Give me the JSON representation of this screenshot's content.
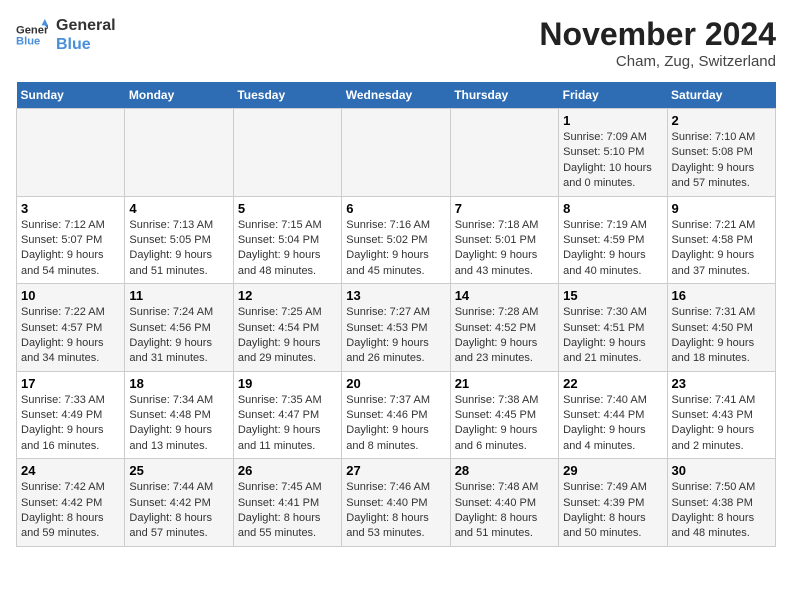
{
  "header": {
    "logo_line1": "General",
    "logo_line2": "Blue",
    "month_title": "November 2024",
    "location": "Cham, Zug, Switzerland"
  },
  "weekdays": [
    "Sunday",
    "Monday",
    "Tuesday",
    "Wednesday",
    "Thursday",
    "Friday",
    "Saturday"
  ],
  "weeks": [
    [
      {
        "day": "",
        "info": ""
      },
      {
        "day": "",
        "info": ""
      },
      {
        "day": "",
        "info": ""
      },
      {
        "day": "",
        "info": ""
      },
      {
        "day": "",
        "info": ""
      },
      {
        "day": "1",
        "info": "Sunrise: 7:09 AM\nSunset: 5:10 PM\nDaylight: 10 hours and 0 minutes."
      },
      {
        "day": "2",
        "info": "Sunrise: 7:10 AM\nSunset: 5:08 PM\nDaylight: 9 hours and 57 minutes."
      }
    ],
    [
      {
        "day": "3",
        "info": "Sunrise: 7:12 AM\nSunset: 5:07 PM\nDaylight: 9 hours and 54 minutes."
      },
      {
        "day": "4",
        "info": "Sunrise: 7:13 AM\nSunset: 5:05 PM\nDaylight: 9 hours and 51 minutes."
      },
      {
        "day": "5",
        "info": "Sunrise: 7:15 AM\nSunset: 5:04 PM\nDaylight: 9 hours and 48 minutes."
      },
      {
        "day": "6",
        "info": "Sunrise: 7:16 AM\nSunset: 5:02 PM\nDaylight: 9 hours and 45 minutes."
      },
      {
        "day": "7",
        "info": "Sunrise: 7:18 AM\nSunset: 5:01 PM\nDaylight: 9 hours and 43 minutes."
      },
      {
        "day": "8",
        "info": "Sunrise: 7:19 AM\nSunset: 4:59 PM\nDaylight: 9 hours and 40 minutes."
      },
      {
        "day": "9",
        "info": "Sunrise: 7:21 AM\nSunset: 4:58 PM\nDaylight: 9 hours and 37 minutes."
      }
    ],
    [
      {
        "day": "10",
        "info": "Sunrise: 7:22 AM\nSunset: 4:57 PM\nDaylight: 9 hours and 34 minutes."
      },
      {
        "day": "11",
        "info": "Sunrise: 7:24 AM\nSunset: 4:56 PM\nDaylight: 9 hours and 31 minutes."
      },
      {
        "day": "12",
        "info": "Sunrise: 7:25 AM\nSunset: 4:54 PM\nDaylight: 9 hours and 29 minutes."
      },
      {
        "day": "13",
        "info": "Sunrise: 7:27 AM\nSunset: 4:53 PM\nDaylight: 9 hours and 26 minutes."
      },
      {
        "day": "14",
        "info": "Sunrise: 7:28 AM\nSunset: 4:52 PM\nDaylight: 9 hours and 23 minutes."
      },
      {
        "day": "15",
        "info": "Sunrise: 7:30 AM\nSunset: 4:51 PM\nDaylight: 9 hours and 21 minutes."
      },
      {
        "day": "16",
        "info": "Sunrise: 7:31 AM\nSunset: 4:50 PM\nDaylight: 9 hours and 18 minutes."
      }
    ],
    [
      {
        "day": "17",
        "info": "Sunrise: 7:33 AM\nSunset: 4:49 PM\nDaylight: 9 hours and 16 minutes."
      },
      {
        "day": "18",
        "info": "Sunrise: 7:34 AM\nSunset: 4:48 PM\nDaylight: 9 hours and 13 minutes."
      },
      {
        "day": "19",
        "info": "Sunrise: 7:35 AM\nSunset: 4:47 PM\nDaylight: 9 hours and 11 minutes."
      },
      {
        "day": "20",
        "info": "Sunrise: 7:37 AM\nSunset: 4:46 PM\nDaylight: 9 hours and 8 minutes."
      },
      {
        "day": "21",
        "info": "Sunrise: 7:38 AM\nSunset: 4:45 PM\nDaylight: 9 hours and 6 minutes."
      },
      {
        "day": "22",
        "info": "Sunrise: 7:40 AM\nSunset: 4:44 PM\nDaylight: 9 hours and 4 minutes."
      },
      {
        "day": "23",
        "info": "Sunrise: 7:41 AM\nSunset: 4:43 PM\nDaylight: 9 hours and 2 minutes."
      }
    ],
    [
      {
        "day": "24",
        "info": "Sunrise: 7:42 AM\nSunset: 4:42 PM\nDaylight: 8 hours and 59 minutes."
      },
      {
        "day": "25",
        "info": "Sunrise: 7:44 AM\nSunset: 4:42 PM\nDaylight: 8 hours and 57 minutes."
      },
      {
        "day": "26",
        "info": "Sunrise: 7:45 AM\nSunset: 4:41 PM\nDaylight: 8 hours and 55 minutes."
      },
      {
        "day": "27",
        "info": "Sunrise: 7:46 AM\nSunset: 4:40 PM\nDaylight: 8 hours and 53 minutes."
      },
      {
        "day": "28",
        "info": "Sunrise: 7:48 AM\nSunset: 4:40 PM\nDaylight: 8 hours and 51 minutes."
      },
      {
        "day": "29",
        "info": "Sunrise: 7:49 AM\nSunset: 4:39 PM\nDaylight: 8 hours and 50 minutes."
      },
      {
        "day": "30",
        "info": "Sunrise: 7:50 AM\nSunset: 4:38 PM\nDaylight: 8 hours and 48 minutes."
      }
    ]
  ]
}
